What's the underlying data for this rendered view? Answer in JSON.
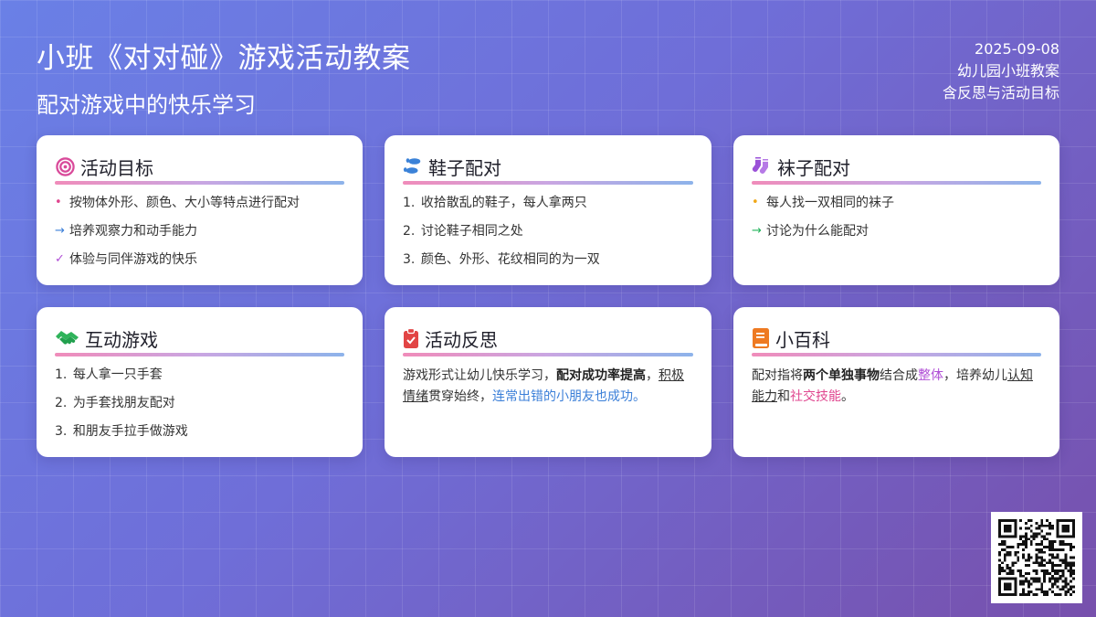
{
  "header": {
    "title": "小班《对对碰》游戏活动教案",
    "subtitle": "配对游戏中的快乐学习",
    "date": "2025-09-08",
    "meta1": "幼儿园小班教案",
    "meta2": "含反思与活动目标"
  },
  "cards": {
    "goals": {
      "title": "活动目标",
      "icon": "target-icon",
      "items": [
        {
          "bullet": "•",
          "text": "按物体外形、颜色、大小等特点进行配对"
        },
        {
          "bullet": "→",
          "text": "培养观察力和动手能力"
        },
        {
          "bullet": "✓",
          "text": "体验与同伴游戏的快乐"
        }
      ]
    },
    "shoes": {
      "title": "鞋子配对",
      "icon": "footprints-icon",
      "items": [
        {
          "num": "1.",
          "text": "收拾散乱的鞋子，每人拿两只"
        },
        {
          "num": "2.",
          "text": "讨论鞋子相同之处"
        },
        {
          "num": "3.",
          "text": "颜色、外形、花纹相同的为一双"
        }
      ]
    },
    "socks": {
      "title": "袜子配对",
      "icon": "socks-icon",
      "items": [
        {
          "bullet": "•",
          "text": "每人找一双相同的袜子"
        },
        {
          "bullet": "→",
          "text": "讨论为什么能配对"
        }
      ]
    },
    "game": {
      "title": "互动游戏",
      "icon": "handshake-icon",
      "items": [
        {
          "num": "1.",
          "text": "每人拿一只手套"
        },
        {
          "num": "2.",
          "text": "为手套找朋友配对"
        },
        {
          "num": "3.",
          "text": "和朋友手拉手做游戏"
        }
      ]
    },
    "reflection": {
      "title": "活动反思",
      "icon": "clipboard-check-icon",
      "p1": "游戏形式让幼儿快乐学习，",
      "p2": "配对成功率提高",
      "p3": "，",
      "p4": "积极情绪",
      "p5": "贯穿始终，",
      "p6": "连常出错的小朋友也成功",
      "p7": "。"
    },
    "wiki": {
      "title": "小百科",
      "icon": "book-icon",
      "p1": "配对指将",
      "p2": "两个单独事物",
      "p3": "结合成",
      "p4": "整体",
      "p5": "，培养幼儿",
      "p6": "认知能力",
      "p7": "和",
      "p8": "社交技能",
      "p9": "。"
    }
  },
  "colors": {
    "goal_bullets": [
      "#e0468f",
      "#3b7fd8",
      "#b04ed6"
    ],
    "sock_bullets": [
      "#f0a818",
      "#22b35a"
    ]
  }
}
